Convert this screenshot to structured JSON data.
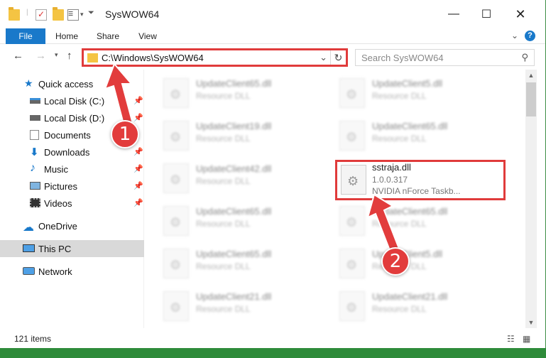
{
  "window": {
    "title": "SysWOW64"
  },
  "ribbon": {
    "tabs": [
      "File",
      "Home",
      "Share",
      "View"
    ],
    "help": "?"
  },
  "nav": {
    "address": "C:\\Windows\\SysWOW64",
    "search_placeholder": "Search SysWOW64"
  },
  "sidebar": {
    "quick_access": "Quick access",
    "items": [
      {
        "label": "Local Disk (C:)"
      },
      {
        "label": "Local Disk (D:)"
      },
      {
        "label": "Documents"
      },
      {
        "label": "Downloads"
      },
      {
        "label": "Music"
      },
      {
        "label": "Pictures"
      },
      {
        "label": "Videos"
      }
    ],
    "onedrive": "OneDrive",
    "thispc": "This PC",
    "network": "Network"
  },
  "files": {
    "left": [
      {
        "name": "UpdateClient65.dll",
        "type": "Resource DLL"
      },
      {
        "name": "UpdateClient19.dll",
        "type": "Resource DLL"
      },
      {
        "name": "UpdateClient42.dll",
        "type": "Resource DLL"
      },
      {
        "name": "UpdateClient65.dll",
        "type": "Resource DLL"
      },
      {
        "name": "UpdateClient65.dll",
        "type": "Resource DLL"
      },
      {
        "name": "UpdateClient21.dll",
        "type": "Resource DLL"
      }
    ],
    "right": [
      {
        "name": "UpdateClient5.dll",
        "type": "Resource DLL"
      },
      {
        "name": "UpdateClient65.dll",
        "type": "Resource DLL"
      },
      {
        "name": "UpdateClient65.dll",
        "type": "Resource DLL"
      },
      {
        "name": "UpdateClient5.dll",
        "type": "Resource DLL"
      },
      {
        "name": "UpdateClient21.dll",
        "type": "Resource DLL"
      }
    ],
    "featured": {
      "name": "sstraja.dll",
      "version": "1.0.0.317",
      "description": "NVIDIA nForce Taskb..."
    }
  },
  "status": {
    "items": "121 items"
  },
  "annotations": {
    "step1": "1",
    "step2": "2"
  },
  "colors": {
    "accent": "#1979ca",
    "annotation": "#e03b3b"
  }
}
